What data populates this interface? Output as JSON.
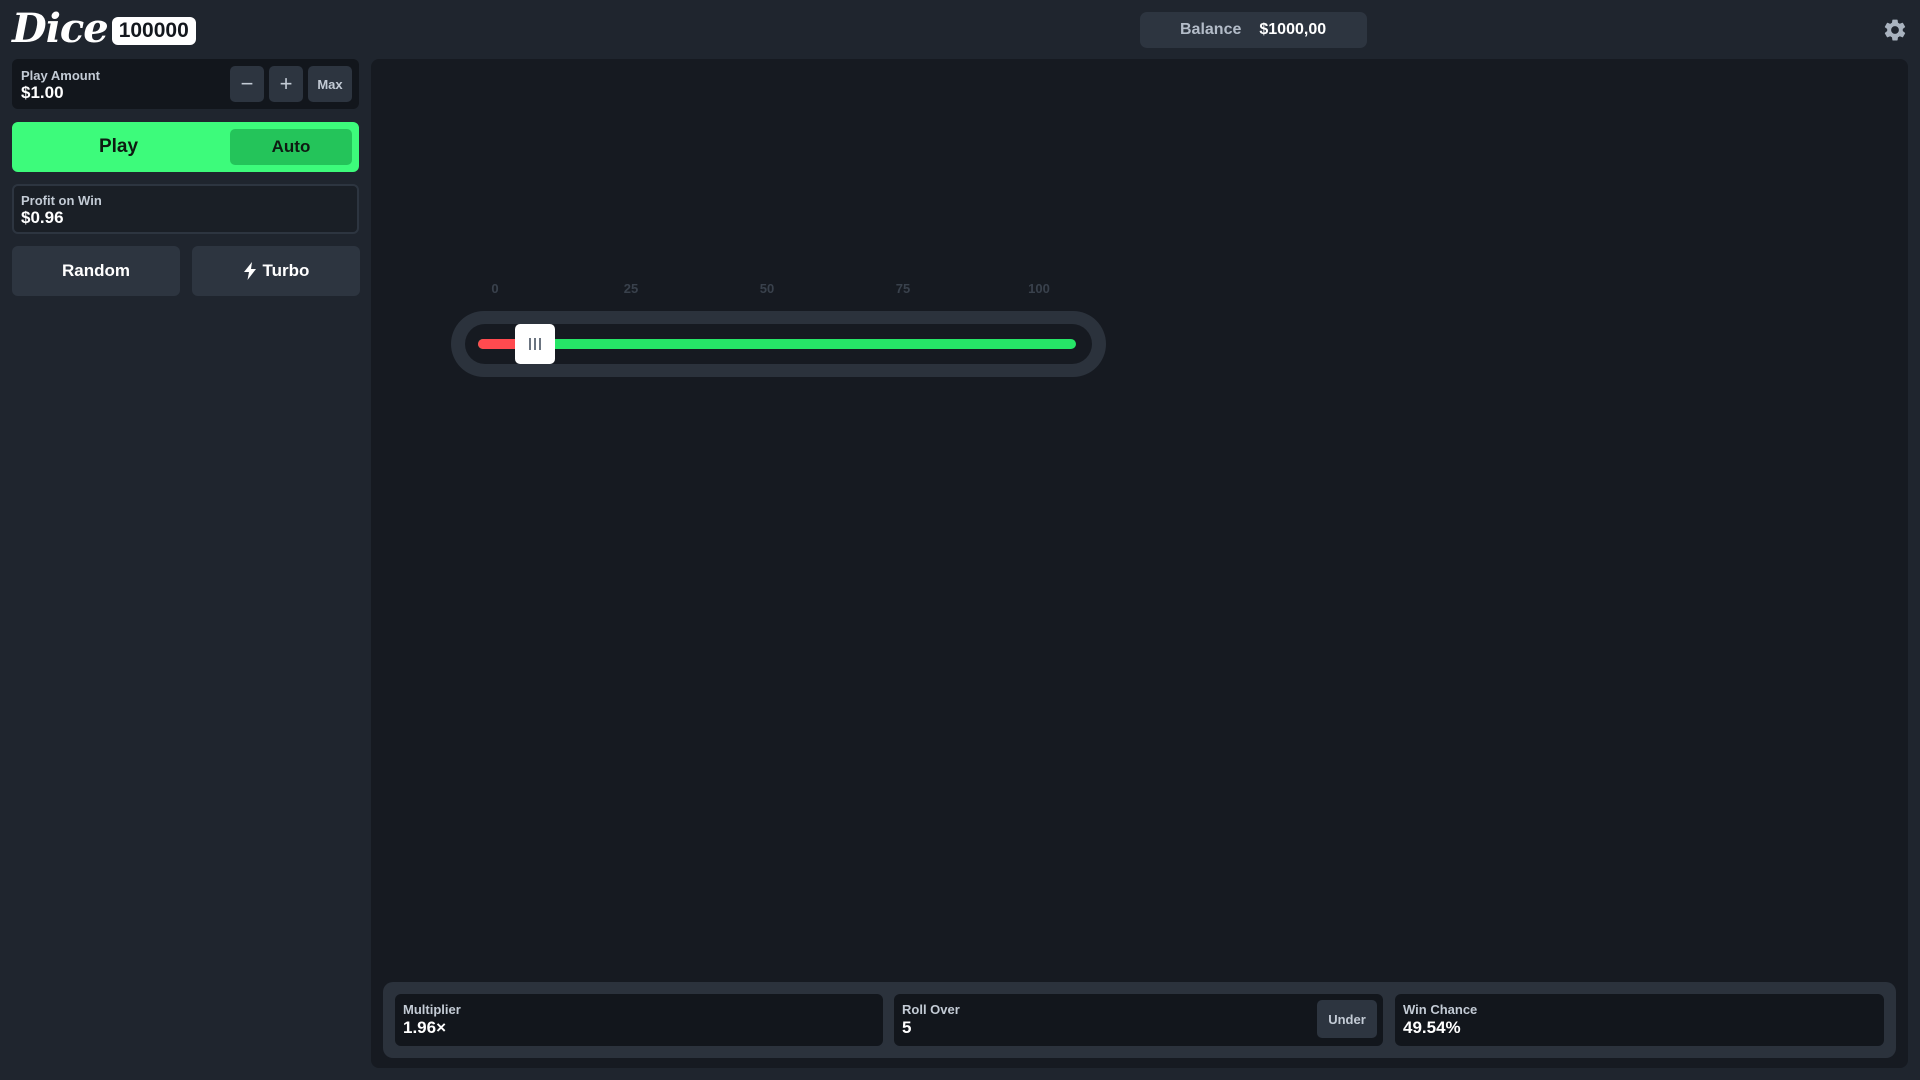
{
  "header": {
    "logo_word": "Dice",
    "logo_badge": "100000",
    "balance_label": "Balance",
    "balance_value": "$1000,00",
    "settings_icon": "gear-icon"
  },
  "controls": {
    "play_amount_label": "Play Amount",
    "play_amount_value": "$1.00",
    "minus_label": "−",
    "plus_label": "+",
    "max_label": "Max",
    "play_label": "Play",
    "auto_label": "Auto",
    "profit_label": "Profit on Win",
    "profit_value": "$0.96",
    "random_label": "Random",
    "turbo_label": "Turbo",
    "turbo_icon": "lightning-icon"
  },
  "slider": {
    "ticks": [
      "0",
      "25",
      "50",
      "75",
      "100"
    ],
    "min": 0,
    "max": 100,
    "value": 5,
    "lose_color": "#ff4a4f",
    "win_color": "#26e567"
  },
  "stats": {
    "multiplier_label": "Multiplier",
    "multiplier_value": "1.96×",
    "roll_label": "Roll Over",
    "roll_value": "5",
    "under_label": "Under",
    "chance_label": "Win Chance",
    "chance_value": "49.54%"
  },
  "colors": {
    "accent_green": "#3dfb7b",
    "auto_green": "#24c45a",
    "background": "#1f252e",
    "game_background": "#161a21"
  }
}
